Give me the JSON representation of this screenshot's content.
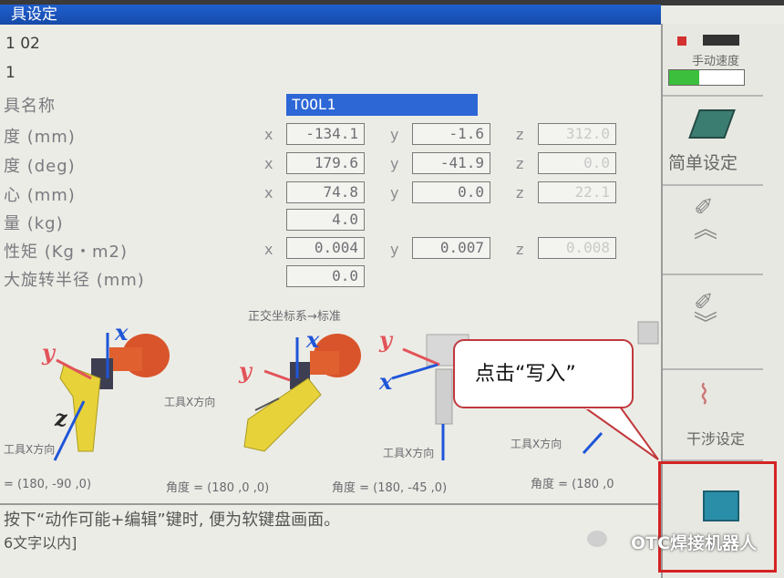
{
  "window": {
    "title": "具设定",
    "tool_number": "1 02",
    "sub_label": "1"
  },
  "tool": {
    "name_label": "具名称",
    "name_value": "TOOL1",
    "rows": [
      {
        "label": "度 (mm)",
        "x": "-134.1",
        "y": "-1.6",
        "z": "312.0"
      },
      {
        "label": "度 (deg)",
        "x": "179.6",
        "y": "-41.9",
        "z": "0.0"
      },
      {
        "label": "心 (mm)",
        "x": "74.8",
        "y": "0.0",
        "z": "22.1"
      },
      {
        "label": "量 (kg)",
        "single": "4.0"
      },
      {
        "label": "性矩 (Kg・m2)",
        "x": "0.004",
        "y": "0.007",
        "z": "0.008"
      },
      {
        "label": "大旋转半径 (mm)",
        "single": "0.0"
      }
    ],
    "axis_names": {
      "x": "x",
      "y": "y",
      "z": "z"
    }
  },
  "diagram": {
    "heading": "正交坐标系→标准",
    "axis_x": "x",
    "axis_y": "y",
    "axis_z": "z",
    "caption_tool_x": "工具X方向",
    "angles": [
      "= (180, -90 ,0)",
      "角度 = (180 ,0 ,0)",
      "角度 = (180, -45 ,0)",
      "角度 = (180 ,0"
    ]
  },
  "status": {
    "line1": "按下“动作可能+编辑”键时, 便为软键盘画面。",
    "line2": "6文字以内]"
  },
  "right_panel": {
    "speed_label": "手动速度",
    "simple_setting": "简单设定",
    "interference": "干涉设定"
  },
  "callout": {
    "text": "点击“写入”"
  },
  "watermark": "OTC焊接机器人",
  "colors": {
    "accent": "#2d67d6",
    "highlight": "#d42323"
  },
  "icons": [
    "simple-setting-icon",
    "page-up-icon",
    "page-down-icon",
    "interference-icon",
    "write-icon",
    "wechat-icon"
  ]
}
